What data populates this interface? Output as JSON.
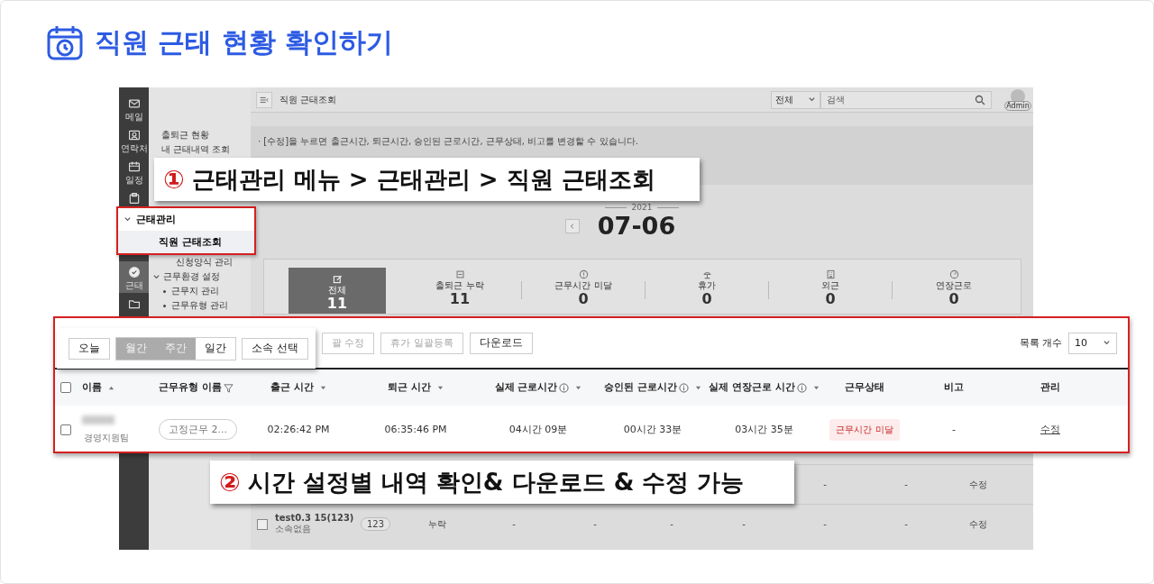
{
  "title": "직원 근태 현황 확인하기",
  "rail_top": [
    {
      "label": "메일",
      "kind": "mail",
      "selected": false
    },
    {
      "label": "연락처",
      "kind": "contact",
      "selected": false
    },
    {
      "label": "일정",
      "kind": "calendar",
      "selected": false
    },
    {
      "kind": "clipboard",
      "selected": false
    }
  ],
  "rail_bottom": [
    {
      "label": "근태",
      "kind": "check",
      "selected": true
    },
    {
      "kind": "folder",
      "selected": false
    }
  ],
  "sidebar": {
    "top": [
      {
        "label": "출퇴근 현황"
      },
      {
        "label": "내 근태내역 조회"
      }
    ],
    "bottom": [
      {
        "label": "신청양식 관리",
        "kind": "sub"
      },
      {
        "label": "근무환경 설정",
        "kind": "group",
        "expanded": true,
        "children": [
          {
            "label": "근무지 관리"
          },
          {
            "label": "근무유형 관리"
          }
        ]
      }
    ]
  },
  "topbar": {
    "title": "직원 근태조회",
    "scope": "전체",
    "search_placeholder": "검색",
    "avatar_label": "Admin"
  },
  "notice": [
    "· [수정]을 누르면 출근시간, 퇴근시간, 승인된 근로시간, 근무상태, 비고를 변경할 수 있습니다."
  ],
  "date": {
    "year": "2021",
    "day": "07-06"
  },
  "stats": [
    {
      "label": "전체",
      "value": "11",
      "selected": true,
      "kind": "edit"
    },
    {
      "label": "출퇴근 누락",
      "value": "11",
      "selected": false,
      "kind": "doc"
    },
    {
      "label": "근무시간 미달",
      "value": "0",
      "selected": false,
      "kind": "alert"
    },
    {
      "label": "휴가",
      "value": "0",
      "selected": false,
      "kind": "beach"
    },
    {
      "label": "외근",
      "value": "0",
      "selected": false,
      "kind": "building"
    },
    {
      "label": "연장근로",
      "value": "0",
      "selected": false,
      "kind": "clock"
    }
  ],
  "base_rows": [
    {
      "dashes": [
        "-",
        "-"
      ],
      "action": "수정"
    },
    {
      "checked": false,
      "name": "test0.3 15(123)",
      "team": "소속없음",
      "type": "123",
      "in": "누락",
      "dashes": [
        "-",
        "-",
        "-",
        "-",
        "-",
        "-"
      ],
      "action": "수정"
    }
  ],
  "callouts": [
    {
      "number": "①",
      "text": "근태관리 메뉴 > 근태관리 > 직원 근태조회"
    },
    {
      "number": "②",
      "text": "시간 설정별 내역 확인& 다운로드 & 수정 가능"
    }
  ],
  "menu_highlight": {
    "group": "근태관리",
    "expanded": true,
    "item": "직원 근태조회",
    "selected": true
  },
  "panel": {
    "today": "오늘",
    "periods": [
      {
        "label": "월간",
        "selected": true
      },
      {
        "label": "주간",
        "selected": true
      },
      {
        "label": "일간",
        "selected": false
      }
    ],
    "org": "소속 선택",
    "actions": [
      {
        "label": "괄 수정",
        "disabled": true
      },
      {
        "label": "휴가 일괄등록",
        "disabled": true
      },
      {
        "label": "다운로드",
        "disabled": false
      }
    ],
    "page_size_label": "목록 개수",
    "page_size": "10",
    "header_checked": false,
    "columns": [
      {
        "label": "이름",
        "info": false
      },
      {
        "label": "근무유형 이름",
        "info": false
      },
      {
        "label": "출근 시간",
        "info": false
      },
      {
        "label": "퇴근 시간",
        "info": false
      },
      {
        "label": "실제 근로시간",
        "info": true
      },
      {
        "label": "승인된 근로시간",
        "info": true
      },
      {
        "label": "실제 연장근로 시간",
        "info": true
      },
      {
        "label": "근무상태",
        "info": false
      },
      {
        "label": "비고",
        "info": false
      },
      {
        "label": "관리",
        "info": false
      }
    ],
    "row": {
      "checked": false,
      "team": "경영지원팀",
      "type": "고정근무 2...",
      "in": "02:26:42 PM",
      "out": "06:35:46 PM",
      "actual": "04시간 09분",
      "approved": "00시간 33분",
      "overtime": "03시간 35분",
      "status": "근무시간 미달",
      "note": "-",
      "action": "수정"
    }
  }
}
